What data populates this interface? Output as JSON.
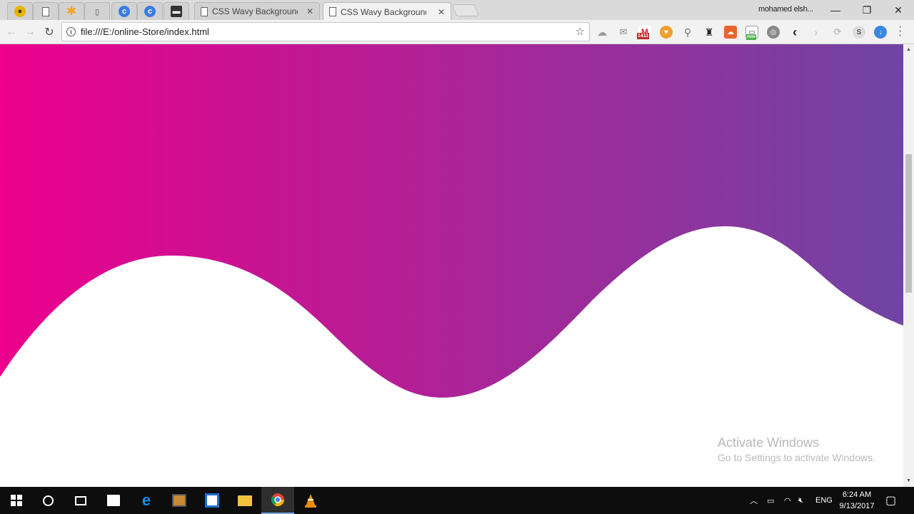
{
  "browser": {
    "tabs": [
      {
        "title": "CSS Wavy Background -",
        "close": "✕",
        "active": false
      },
      {
        "title": "CSS Wavy Background -",
        "close": "✕",
        "active": true
      }
    ],
    "profile_name": "mohamed elsh...",
    "window_controls": {
      "minimize": "—",
      "restore": "❐",
      "close": "✕"
    },
    "address": "file:///E:/online-Store/index.html",
    "ext_badge": "1411",
    "ext_new_label": "new"
  },
  "page": {
    "gradient": {
      "start": "#ec008c",
      "end": "#6f45a3"
    },
    "wave_fill": "#ffffff"
  },
  "watermark": {
    "line1": "Activate Windows",
    "line2": "Go to Settings to activate Windows."
  },
  "taskbar": {
    "language": "ENG",
    "time": "6:24 AM",
    "date": "9/13/2017"
  }
}
